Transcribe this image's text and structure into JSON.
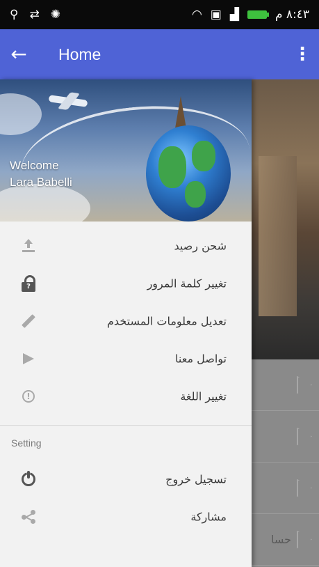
{
  "status_bar": {
    "left_icons": [
      "usb-icon",
      "sync-icon",
      "settings-bug-icon"
    ],
    "right_icons": [
      "wifi-icon",
      "notification-icon",
      "signal-icon",
      "battery-icon"
    ],
    "time": "٨:٤٣ م"
  },
  "app_bar": {
    "title": "Home",
    "back_icon": "arrow-back-icon",
    "overflow_icon": "more-vert-icon"
  },
  "drawer": {
    "header": {
      "welcome_line": "Welcome",
      "user_name": "Lara Babelli"
    },
    "items": [
      {
        "label": "شحن رصيد",
        "icon": "upload-icon"
      },
      {
        "label": "تغيير كلمة المرور",
        "icon": "lock-icon"
      },
      {
        "label": "تعديل معلومات المستخدم",
        "icon": "pencil-icon"
      },
      {
        "label": "تواصل معنا",
        "icon": "send-icon"
      },
      {
        "label": "تغيير اللغة",
        "icon": "info-icon"
      }
    ],
    "section_title": "Setting",
    "settings_items": [
      {
        "label": "تسجيل خروج",
        "icon": "power-icon"
      },
      {
        "label": "مشاركة",
        "icon": "share-icon"
      }
    ]
  },
  "background": {
    "partial_text": "حسا"
  },
  "colors": {
    "app_bar": "#4f63d6",
    "status_bar": "#0a0a0a",
    "drawer_bg": "#f2f2f2"
  }
}
